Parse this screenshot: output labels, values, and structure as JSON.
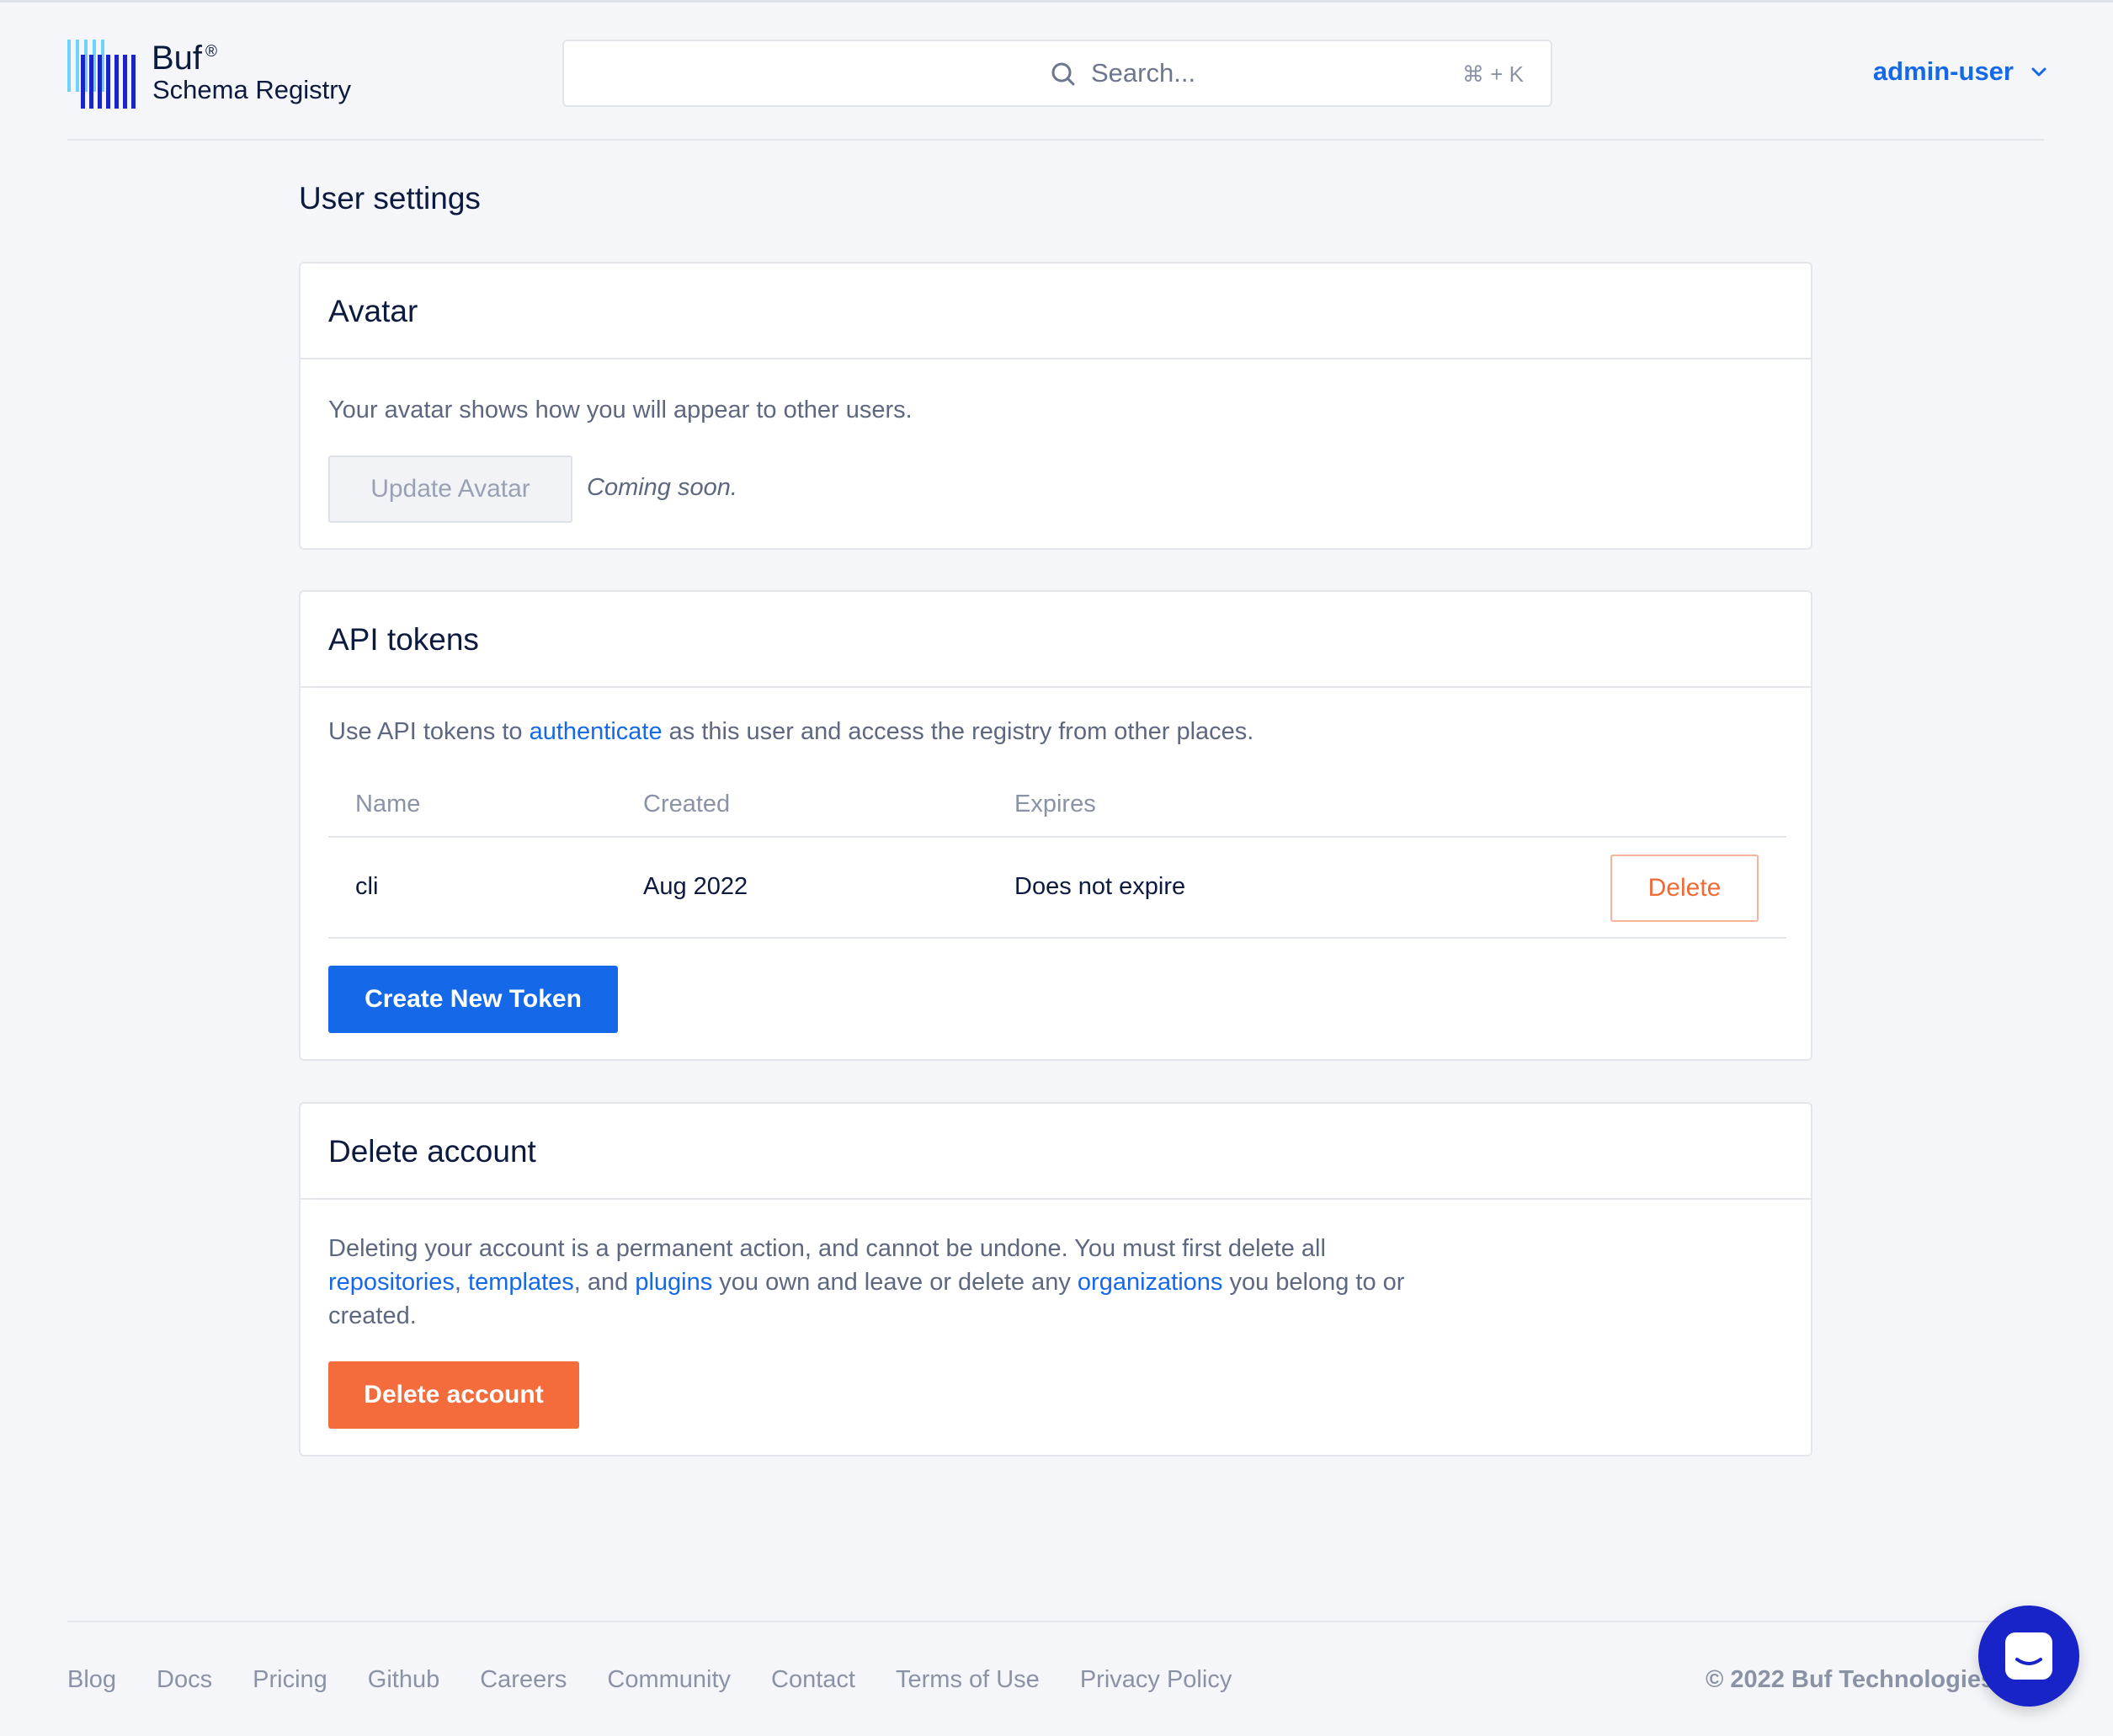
{
  "header": {
    "brand_name": "Buf",
    "brand_mark": "®",
    "brand_subtitle": "Schema Registry",
    "search_placeholder": "Search...",
    "search_shortcut": "⌘ + K",
    "user_name": "admin-user"
  },
  "page": {
    "title": "User settings"
  },
  "avatar_card": {
    "title": "Avatar",
    "description": "Your avatar shows how you will appear to other users.",
    "button_label": "Update Avatar",
    "note": "Coming soon."
  },
  "tokens_card": {
    "title": "API tokens",
    "desc_before": "Use API tokens to ",
    "desc_link": "authenticate",
    "desc_after": " as this user and access the registry from other places.",
    "columns": [
      "Name",
      "Created",
      "Expires"
    ],
    "rows": [
      {
        "name": "cli",
        "created": "Aug 2022",
        "expires": "Does not expire",
        "action": "Delete"
      }
    ],
    "create_button": "Create New Token"
  },
  "delete_card": {
    "title": "Delete account",
    "line1": "Deleting your account is a permanent action, and cannot be undone. You must first delete all",
    "link_repos": "repositories",
    "sep1": ", ",
    "link_templates": "templates",
    "sep2": ", and ",
    "link_plugins": "plugins",
    "mid": " you own and leave or delete any ",
    "link_orgs": "organizations",
    "end": " you belong to or",
    "line3": "created.",
    "button_label": "Delete account"
  },
  "footer": {
    "links": [
      "Blog",
      "Docs",
      "Pricing",
      "Github",
      "Careers",
      "Community",
      "Contact",
      "Terms of Use",
      "Privacy Policy"
    ],
    "copyright": "© 2022 Buf Technologies"
  },
  "colors": {
    "accent": "#1568e8",
    "danger": "#f56c3c",
    "chat_bubble": "#1824c8"
  },
  "icons": [
    "buf-logo-icon",
    "search-icon",
    "chevron-down-icon",
    "chat-icon"
  ]
}
